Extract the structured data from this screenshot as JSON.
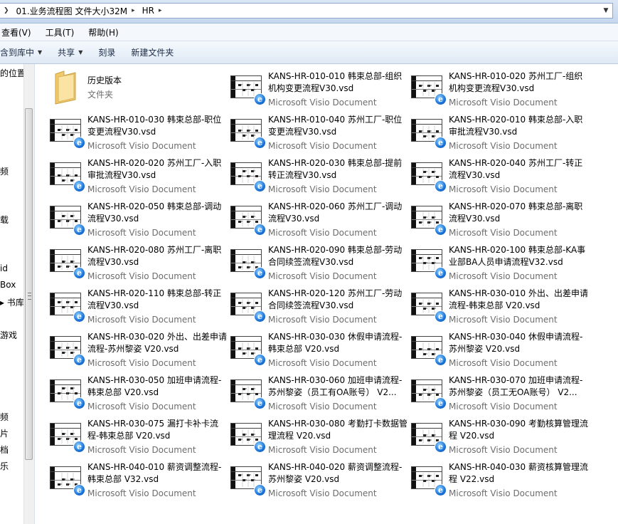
{
  "address": {
    "segments": [
      "01.业务流程图 文件大小32M",
      "HR"
    ]
  },
  "menu": {
    "items": [
      "查看(V)",
      "工具(T)",
      "帮助(H)"
    ]
  },
  "toolbar": {
    "items": [
      "含到库中",
      "共享",
      "刻录",
      "新建文件夹"
    ]
  },
  "nav": {
    "items": [
      "的位置",
      "频",
      "载",
      "id",
      "Box",
      "书库",
      "游戏",
      "频",
      "片",
      "档",
      "乐"
    ]
  },
  "files": [
    {
      "name": "历史版本",
      "type": "文件夹"
    },
    {
      "name": "KANS-HR-010-010 韩束总部-组织机构变更流程V30.vsd",
      "type": "Microsoft Visio Document"
    },
    {
      "name": "KANS-HR-010-020 苏州工厂-组织机构变更流程V30.vsd",
      "type": "Microsoft Visio Document"
    },
    {
      "name": "KANS-HR-010-030 韩束总部-职位变更流程V30.vsd",
      "type": "Microsoft Visio Document"
    },
    {
      "name": "KANS-HR-010-040 苏州工厂-职位变更流程V30.vsd",
      "type": "Microsoft Visio Document"
    },
    {
      "name": "KANS-HR-020-010 韩束总部-入职审批流程V30.vsd",
      "type": "Microsoft Visio Document"
    },
    {
      "name": "KANS-HR-020-020 苏州工厂-入职审批流程V30.vsd",
      "type": "Microsoft Visio Document"
    },
    {
      "name": "KANS-HR-020-030 韩束总部-提前转正流程V30.vsd",
      "type": "Microsoft Visio Document"
    },
    {
      "name": "KANS-HR-020-040 苏州工厂-转正流程V30.vsd",
      "type": "Microsoft Visio Document"
    },
    {
      "name": "KANS-HR-020-050 韩束总部-调动流程V30.vsd",
      "type": "Microsoft Visio Document"
    },
    {
      "name": "KANS-HR-020-060 苏州工厂-调动流程V30.vsd",
      "type": "Microsoft Visio Document"
    },
    {
      "name": "KANS-HR-020-070 韩束总部-离职流程V30.vsd",
      "type": "Microsoft Visio Document"
    },
    {
      "name": "KANS-HR-020-080 苏州工厂-离职流程V30.vsd",
      "type": "Microsoft Visio Document"
    },
    {
      "name": "KANS-HR-020-090 韩束总部-劳动合同续签流程V30.vsd",
      "type": "Microsoft Visio Document"
    },
    {
      "name": "KANS-HR-020-100 韩束总部-KA事业部BA人员申请流程V32.vsd",
      "type": "Microsoft Visio Document"
    },
    {
      "name": "KANS-HR-020-110 韩束总部-转正流程V30.vsd",
      "type": "Microsoft Visio Document"
    },
    {
      "name": "KANS-HR-020-120 苏州工厂-劳动合同续签流程V30.vsd",
      "type": "Microsoft Visio Document"
    },
    {
      "name": "KANS-HR-030-010 外出、出差申请流程-韩束总部 V20.vsd",
      "type": "Microsoft Visio Document"
    },
    {
      "name": "KANS-HR-030-020 外出、出差申请流程-苏州黎姿 V20.vsd",
      "type": "Microsoft Visio Document"
    },
    {
      "name": "KANS-HR-030-030 休假申请流程-韩束总部 V20.vsd",
      "type": "Microsoft Visio Document"
    },
    {
      "name": "KANS-HR-030-040 休假申请流程-苏州黎姿 V20.vsd",
      "type": "Microsoft Visio Document"
    },
    {
      "name": "KANS-HR-030-050 加班申请流程-韩束总部 V20.vsd",
      "type": "Microsoft Visio Document"
    },
    {
      "name": "KANS-HR-030-060 加班申请流程-苏州黎姿（员工有OA账号） V2...",
      "type": "Microsoft Visio Document"
    },
    {
      "name": "KANS-HR-030-070 加班申请流程-苏州黎姿（员工无OA账号） V2...",
      "type": "Microsoft Visio Document"
    },
    {
      "name": "KANS-HR-030-075 漏打卡补卡流程-韩束总部 V20.vsd",
      "type": "Microsoft Visio Document"
    },
    {
      "name": "KANS-HR-030-080 考勤打卡数据管理流程 V20.vsd",
      "type": "Microsoft Visio Document"
    },
    {
      "name": "KANS-HR-030-090 考勤核算管理流程 V20.vsd",
      "type": "Microsoft Visio Document"
    },
    {
      "name": "KANS-HR-040-010 薪资调整流程-韩束总部 V32.vsd",
      "type": "Microsoft Visio Document"
    },
    {
      "name": "KANS-HR-040-020 薪资调整流程-苏州黎姿 V20.vsd",
      "type": "Microsoft Visio Document"
    },
    {
      "name": "KANS-HR-040-030 薪资核算管理流程 V22.vsd",
      "type": "Microsoft Visio Document"
    }
  ]
}
